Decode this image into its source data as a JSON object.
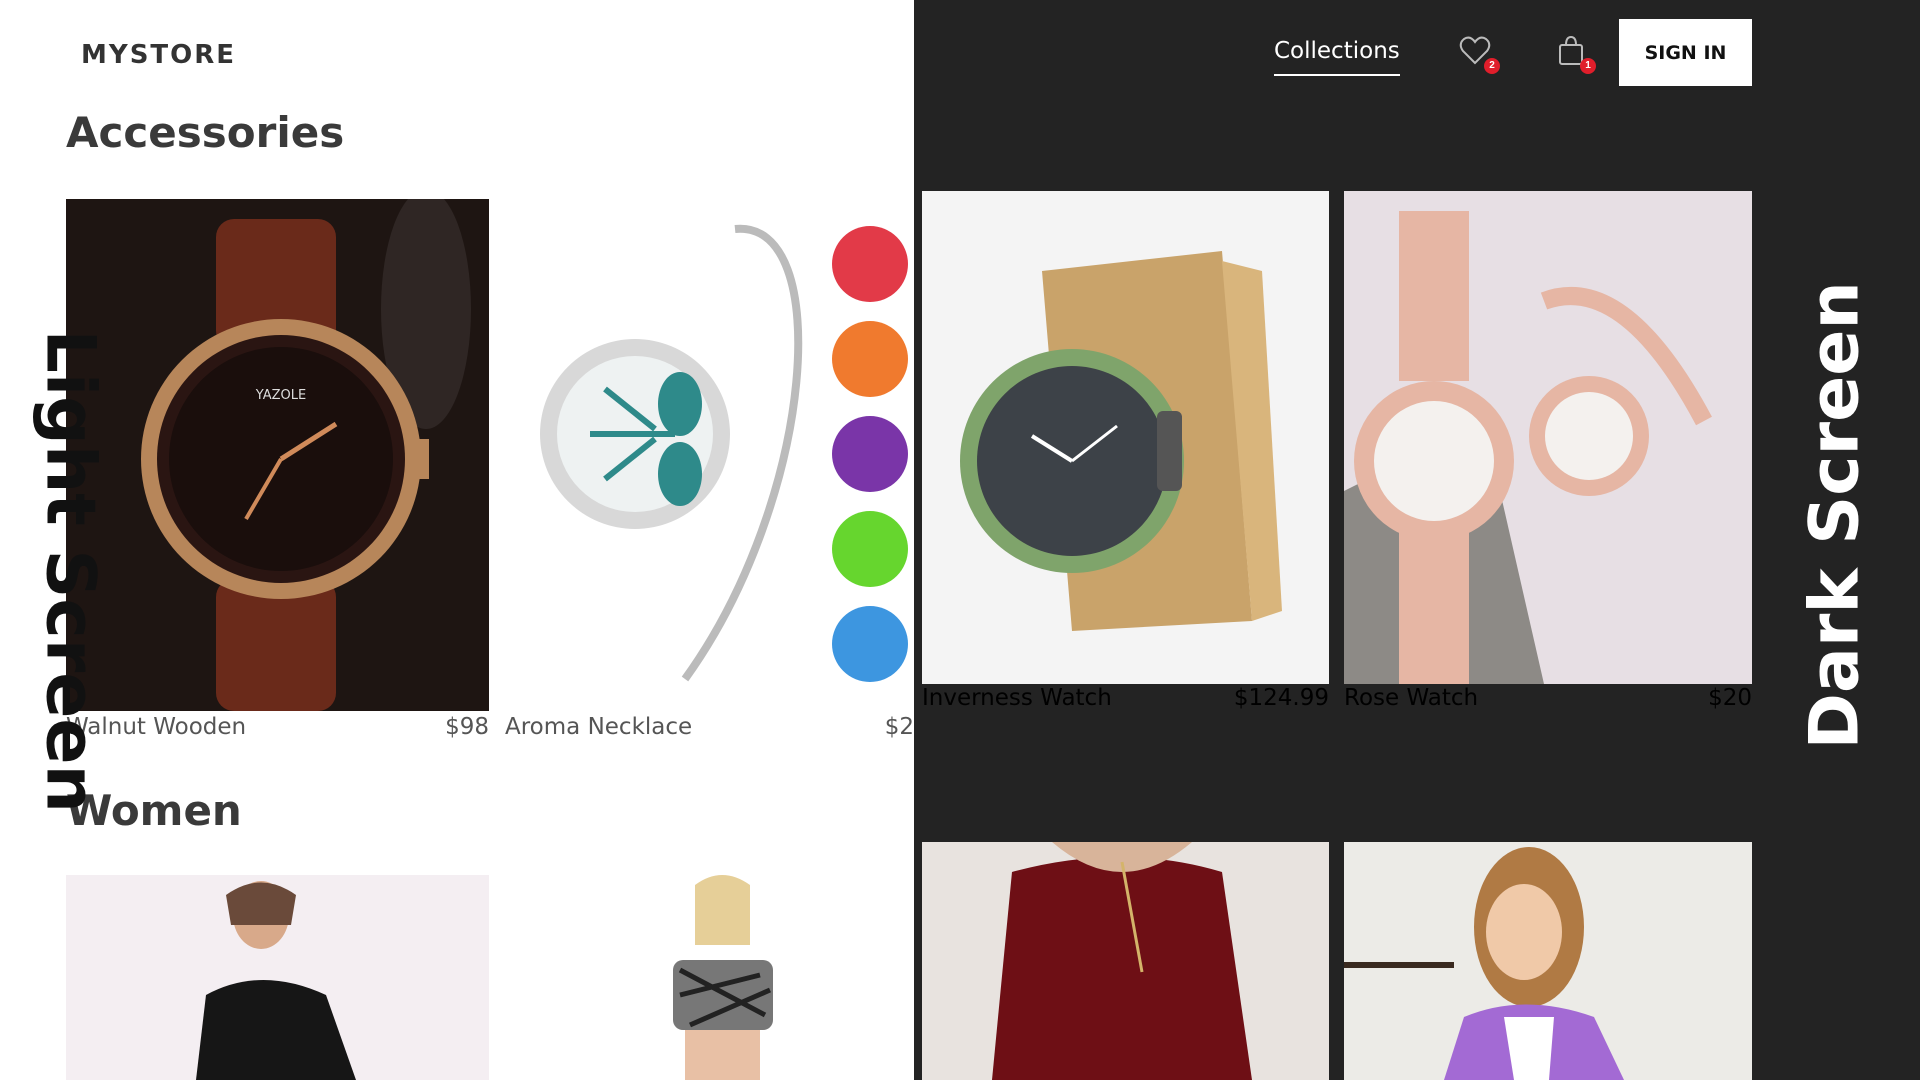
{
  "light": {
    "brand": "MYSTORE",
    "sections": [
      {
        "title": "Accessories"
      },
      {
        "title": "Women"
      }
    ],
    "products": [
      {
        "name": "Walnut Wooden",
        "price": "$98"
      },
      {
        "name": "Aroma Necklace",
        "price": "$2"
      }
    ],
    "side_label": "Light Screen"
  },
  "dark": {
    "nav": {
      "collections": "Collections"
    },
    "wishlist": {
      "icon": "heart-icon",
      "count": "2"
    },
    "cart": {
      "icon": "bag-icon",
      "count": "1"
    },
    "signin_label": "SIGN IN",
    "products": [
      {
        "name": "Inverness Watch",
        "price": "$124.99"
      },
      {
        "name": "Rose Watch",
        "price": "$20"
      }
    ],
    "side_label": "Dark Screen"
  },
  "colors": {
    "dark_bg": "#232323",
    "badge": "#e01e2b"
  }
}
